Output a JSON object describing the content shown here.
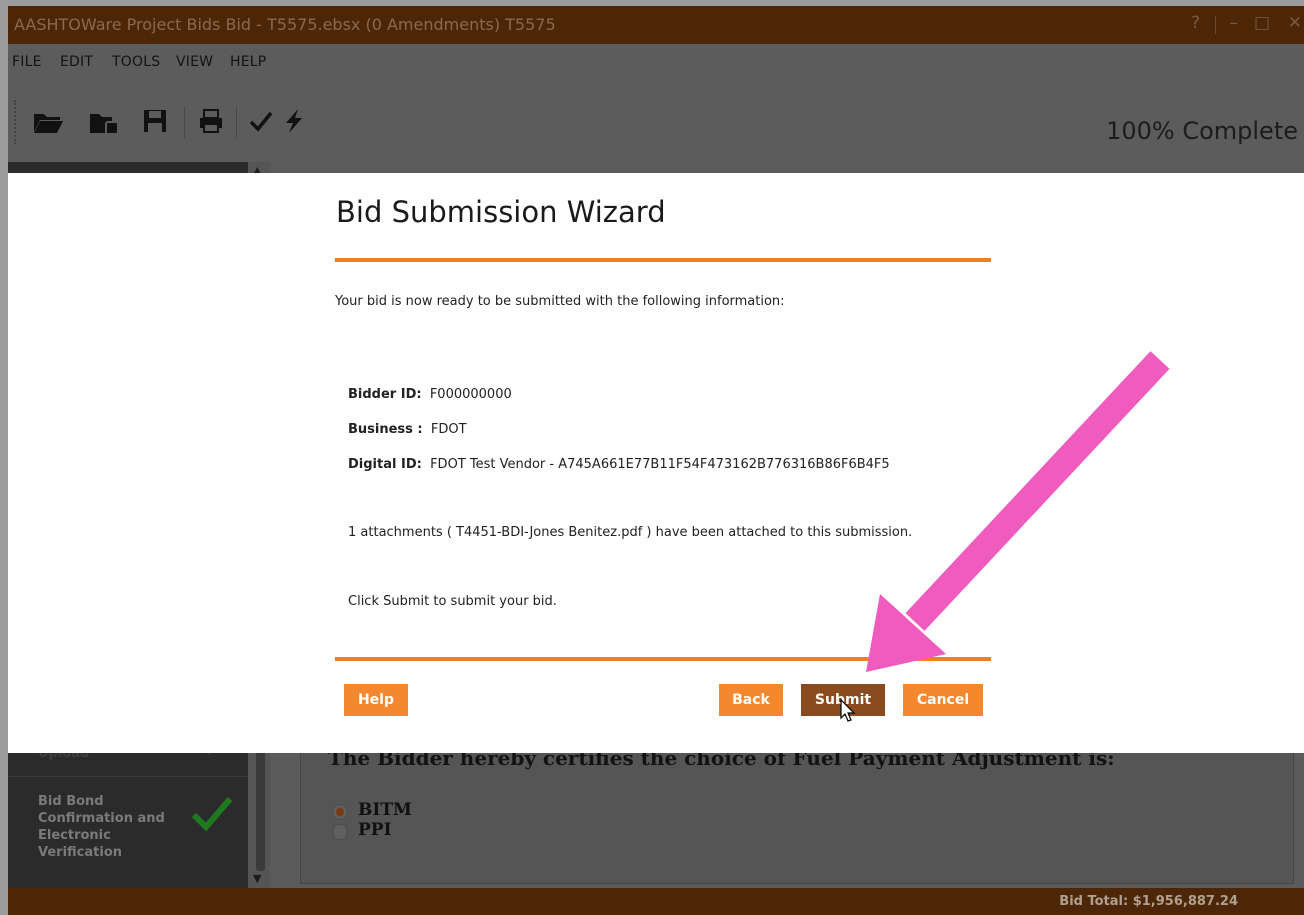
{
  "window": {
    "title": "AASHTOWare Project Bids Bid - T5575.ebsx (0 Amendments) T5575",
    "controls": [
      "?",
      "–",
      "□",
      "✕"
    ]
  },
  "menu": {
    "items": [
      "FILE",
      "EDIT",
      "TOOLS",
      "VIEW",
      "HELP"
    ]
  },
  "toolbar": {
    "icons": [
      "open-folder-icon",
      "export-icon",
      "save-icon",
      "print-icon",
      "check-icon",
      "lightning-icon"
    ],
    "progress_text": "100% Complete",
    "progress": 1.0
  },
  "sidebar": {
    "partial_item": "Upload",
    "item": {
      "label": "Bid Bond Confirmation and Electronic Verification",
      "status": "complete"
    }
  },
  "content": {
    "certify_text": "The Bidder hereby certifies the choice of Fuel Payment Adjustment is:",
    "options": [
      {
        "label": "BITM",
        "checked": true
      },
      {
        "label": "PPI",
        "checked": false
      }
    ]
  },
  "statusbar": {
    "bid_total": "Bid Total: $1,956,887.24"
  },
  "wizard": {
    "title": "Bid Submission Wizard",
    "intro": "Your bid is now ready to be submitted with the following information:",
    "bidder_id_label": "Bidder ID:",
    "bidder_id_value": "F000000000",
    "business_label": "Business :",
    "business_value": "FDOT",
    "digital_id_label": "Digital ID:",
    "digital_id_value": "FDOT Test Vendor - A745A661E77B11F54F473162B776316B86F6B4F5",
    "attachments_text": "1 attachments ( T4451-BDI-Jones Benitez.pdf ) have been attached to this submission.",
    "instruction": "Click Submit to submit your bid.",
    "buttons": {
      "help": "Help",
      "back": "Back",
      "submit": "Submit",
      "cancel": "Cancel"
    }
  },
  "colors": {
    "title_bar": "#4d2608",
    "accent_orange": "#f5882e",
    "submit_brown": "#8a4b1e",
    "annotation_arrow": "#f05cbe",
    "check_green": "#1f7a1f"
  }
}
